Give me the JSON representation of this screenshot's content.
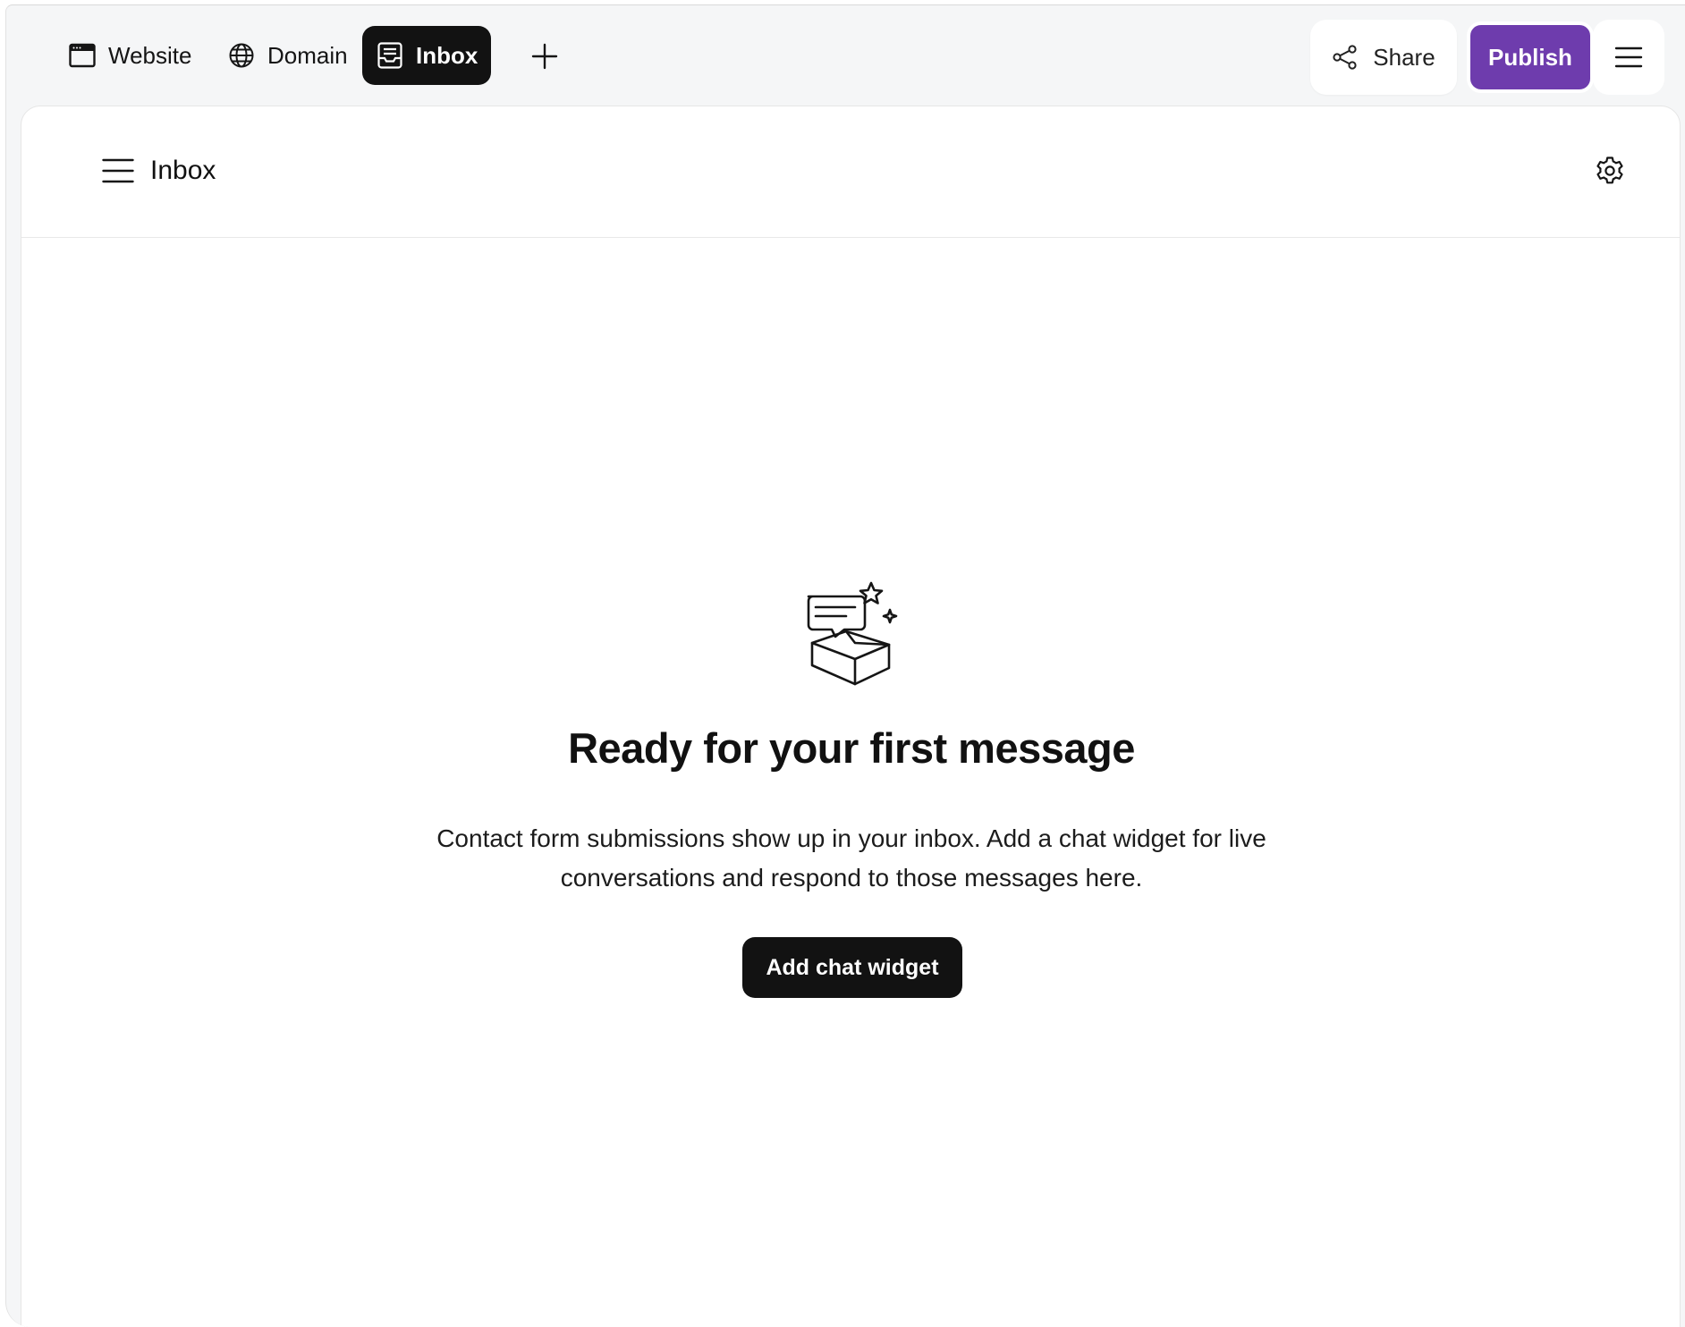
{
  "toolbar": {
    "tabs": [
      {
        "label": "Website",
        "icon": "browser-window-icon",
        "active": false
      },
      {
        "label": "Domain",
        "icon": "globe-icon",
        "active": false
      },
      {
        "label": "Inbox",
        "icon": "inbox-icon",
        "active": true
      }
    ],
    "add_tab_icon": "plus-icon",
    "share_label": "Share",
    "publish_label": "Publish",
    "menu_icon": "hamburger-menu-icon"
  },
  "panel": {
    "title": "Inbox",
    "menu_icon": "hamburger-menu-icon",
    "settings_icon": "gear-icon"
  },
  "empty_state": {
    "illustration": "message-inbox-sparkle-icon",
    "headline": "Ready for your first message",
    "description_line1": "Contact form submissions show up in your inbox. Add a chat widget for live",
    "description_line2": "conversations and respond to those messages here.",
    "cta_label": "Add chat widget"
  },
  "colors": {
    "accent_publish": "#6e3cad",
    "dark_button": "#121212",
    "toolbar_bg": "#f5f6f7"
  }
}
